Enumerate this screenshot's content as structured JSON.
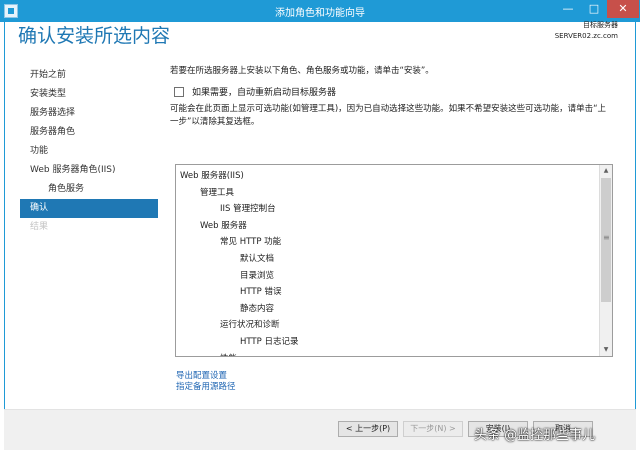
{
  "window": {
    "title": "添加角色和功能向导",
    "minimize": "—",
    "maximize": "□",
    "close": "✕"
  },
  "header": {
    "page_title": "确认安装所选内容",
    "target_server_label": "目标服务器",
    "target_server_name": "SERVER02.zc.com"
  },
  "nav": {
    "items": [
      {
        "label": "开始之前"
      },
      {
        "label": "安装类型"
      },
      {
        "label": "服务器选择"
      },
      {
        "label": "服务器角色"
      },
      {
        "label": "功能"
      },
      {
        "label": "Web 服务器角色(IIS)"
      },
      {
        "label": "角色服务"
      },
      {
        "label": "确认"
      },
      {
        "label": "结果"
      }
    ]
  },
  "content": {
    "intro": "若要在所选服务器上安装以下角色、角色服务或功能，请单击“安装”。",
    "restart_checkbox_label": "如果需要，自动重新启动目标服务器",
    "hint": "可能会在此页面上显示可选功能(如管理工具)，因为已自动选择这些功能。如果不希望安装这些可选功能，请单击“上一步”以清除其复选框。",
    "list": [
      {
        "label": "Web 服务器(IIS)"
      },
      {
        "label": "管理工具"
      },
      {
        "label": "IIS 管理控制台"
      },
      {
        "label": "Web 服务器"
      },
      {
        "label": "常见 HTTP 功能"
      },
      {
        "label": "默认文档"
      },
      {
        "label": "目录浏览"
      },
      {
        "label": "HTTP 错误"
      },
      {
        "label": "静态内容"
      },
      {
        "label": "运行状况和诊断"
      },
      {
        "label": "HTTP 日志记录"
      },
      {
        "label": "性能"
      }
    ],
    "export_link": "导出配置设置",
    "alt_source_link": "指定备用源路径"
  },
  "footer": {
    "prev_button": "< 上一步(P)",
    "next_button": "下一步(N) >",
    "install_button": "安装(I)",
    "cancel_button": "取消"
  },
  "watermark": "头条 @监控那些事儿",
  "colors": {
    "titlebar": "#1f9ad6",
    "accent": "#1f78b4",
    "link": "#1f66b3"
  }
}
